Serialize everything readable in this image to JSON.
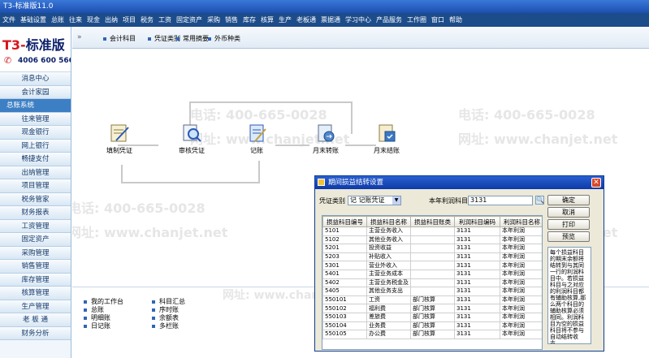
{
  "window_title": "T3-标准版11.0",
  "menu": [
    "文件",
    "基础设置",
    "总账",
    "往来",
    "现金",
    "出纳",
    "项目",
    "税务",
    "工资",
    "固定资产",
    "采购",
    "销售",
    "库存",
    "核算",
    "生产",
    "老板通",
    "票据通",
    "学习中心",
    "产品服务",
    "工作圈",
    "窗口",
    "帮助"
  ],
  "logo": {
    "brand_t3": "T3-",
    "brand_name": "标准版",
    "phone": "4006 600 566"
  },
  "sidebar": [
    "消息中心",
    "会计家园",
    "总账系统",
    "往来管理",
    "现金银行",
    "网上银行",
    "畅捷支付",
    "出纳管理",
    "项目管理",
    "税务管家",
    "财务报表",
    "工资管理",
    "固定资产",
    "采购管理",
    "销售管理",
    "库存管理",
    "核算管理",
    "生产管理",
    "老 板 通",
    "财务分析"
  ],
  "sidebar_active_index": 2,
  "toolbar": [
    "会计科目",
    "凭证类别",
    "常用摘要",
    "外币种类"
  ],
  "watermarks": {
    "phone": "电话: 400-665-0028",
    "site": "网址: www.chanjet.net"
  },
  "flow": [
    "填制凭证",
    "审核凭证",
    "记账",
    "月末转账",
    "月末结账"
  ],
  "links_left": [
    "我的工作台",
    "总账",
    "明细账",
    "日记账"
  ],
  "links_right": [
    "科目汇总",
    "序时账",
    "余额表",
    "多栏账"
  ],
  "dialog": {
    "title": "期间损益结转设置",
    "voucher_type_label": "凭证类别",
    "voucher_type_value": "记  记账凭证",
    "profit_subject_label": "本年利润科目",
    "profit_subject_value": "3131",
    "buttons": [
      "确定",
      "取消",
      "打印",
      "预览"
    ],
    "columns": [
      "损益科目编号",
      "损益科目名称",
      "损益科目账类",
      "利润科目编码",
      "利润科目名称"
    ],
    "rows": [
      [
        "5101",
        "主营业务收入",
        "",
        "3131",
        "本年利润"
      ],
      [
        "5102",
        "其他业务收入",
        "",
        "3131",
        "本年利润"
      ],
      [
        "5201",
        "投资收益",
        "",
        "3131",
        "本年利润"
      ],
      [
        "5203",
        "补贴收入",
        "",
        "3131",
        "本年利润"
      ],
      [
        "5301",
        "营业外收入",
        "",
        "3131",
        "本年利润"
      ],
      [
        "5401",
        "主营业务成本",
        "",
        "3131",
        "本年利润"
      ],
      [
        "5402",
        "主营业务税金及",
        "",
        "3131",
        "本年利润"
      ],
      [
        "5405",
        "其他业务支出",
        "",
        "3131",
        "本年利润"
      ],
      [
        "550101",
        "工资",
        "部门核算",
        "3131",
        "本年利润"
      ],
      [
        "550102",
        "福利费",
        "部门核算",
        "3131",
        "本年利润"
      ],
      [
        "550103",
        "差旅费",
        "部门核算",
        "3131",
        "本年利润"
      ],
      [
        "550104",
        "业务费",
        "部门核算",
        "3131",
        "本年利润"
      ],
      [
        "550105",
        "办公费",
        "部门核算",
        "3131",
        "本年利润"
      ]
    ],
    "note": "每个损益科目的期末余额将结转到与其同一行的利润科目中。若损益科目与之对应的利润科目都有辅助核算,那么两个科目的辅助核算必须相同。利润科目为空的损益科目将不参与自动结转收支。"
  },
  "colors": {
    "menubar": "#1d4c8a",
    "sidebar_active": "#3d7fc4",
    "dialog_title": "#0d3aa8"
  }
}
